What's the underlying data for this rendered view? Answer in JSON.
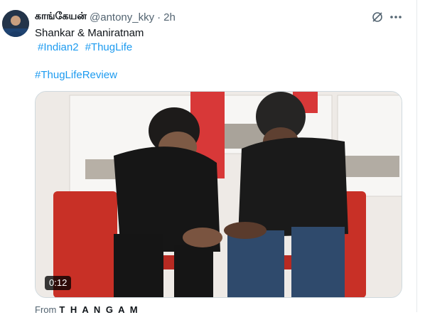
{
  "tweet": {
    "display_name": "காங்கேயன்",
    "handle": "@antony_kky",
    "separator": "·",
    "time": "2h",
    "text_line1": "Shankar & Maniratnam",
    "hashtags_row": [
      "#Indian2",
      "#ThugLife"
    ],
    "hashtag_review": "#ThugLifeReview",
    "icons": {
      "grok": "grok-icon",
      "more": "more-horizontal-icon"
    }
  },
  "media": {
    "type": "video",
    "duration": "0:12",
    "from_label": "From",
    "source_name": "T H A N G A M"
  },
  "colors": {
    "link": "#1d9bf0",
    "secondary_text": "#536471",
    "primary_text": "#0f1419"
  }
}
